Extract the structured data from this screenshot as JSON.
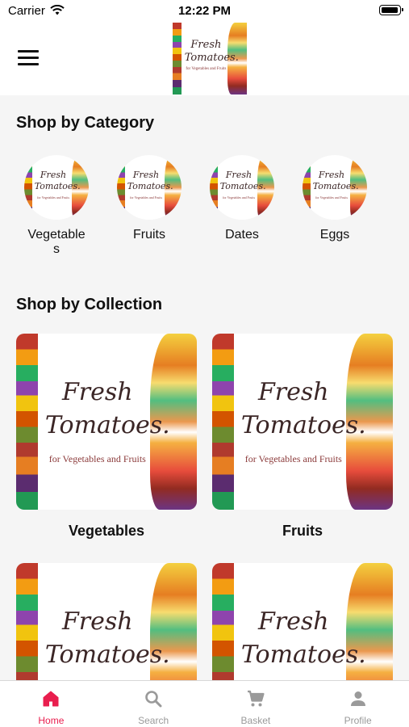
{
  "status_bar": {
    "carrier": "Carrier",
    "time": "12:22 PM"
  },
  "header": {
    "menu_icon": "hamburger-menu-icon",
    "logo": {
      "line1": "Fresh",
      "line2": "Tomatoes.",
      "tagline": "for Vegetables and Fruits"
    }
  },
  "categories": {
    "title": "Shop by Category",
    "items": [
      {
        "label": "Vegetables"
      },
      {
        "label": "Fruits"
      },
      {
        "label": "Dates"
      },
      {
        "label": "Eggs"
      }
    ]
  },
  "collections": {
    "title": "Shop by Collection",
    "items": [
      {
        "label": "Vegetables"
      },
      {
        "label": "Fruits"
      },
      {
        "label": ""
      },
      {
        "label": ""
      }
    ]
  },
  "tab_bar": {
    "items": [
      {
        "label": "Home",
        "icon": "home-icon",
        "active": true
      },
      {
        "label": "Search",
        "icon": "search-icon",
        "active": false
      },
      {
        "label": "Basket",
        "icon": "cart-icon",
        "active": false
      },
      {
        "label": "Profile",
        "icon": "person-icon",
        "active": false
      }
    ],
    "active_color": "#e91e4e",
    "inactive_color": "#9a9a9a"
  }
}
